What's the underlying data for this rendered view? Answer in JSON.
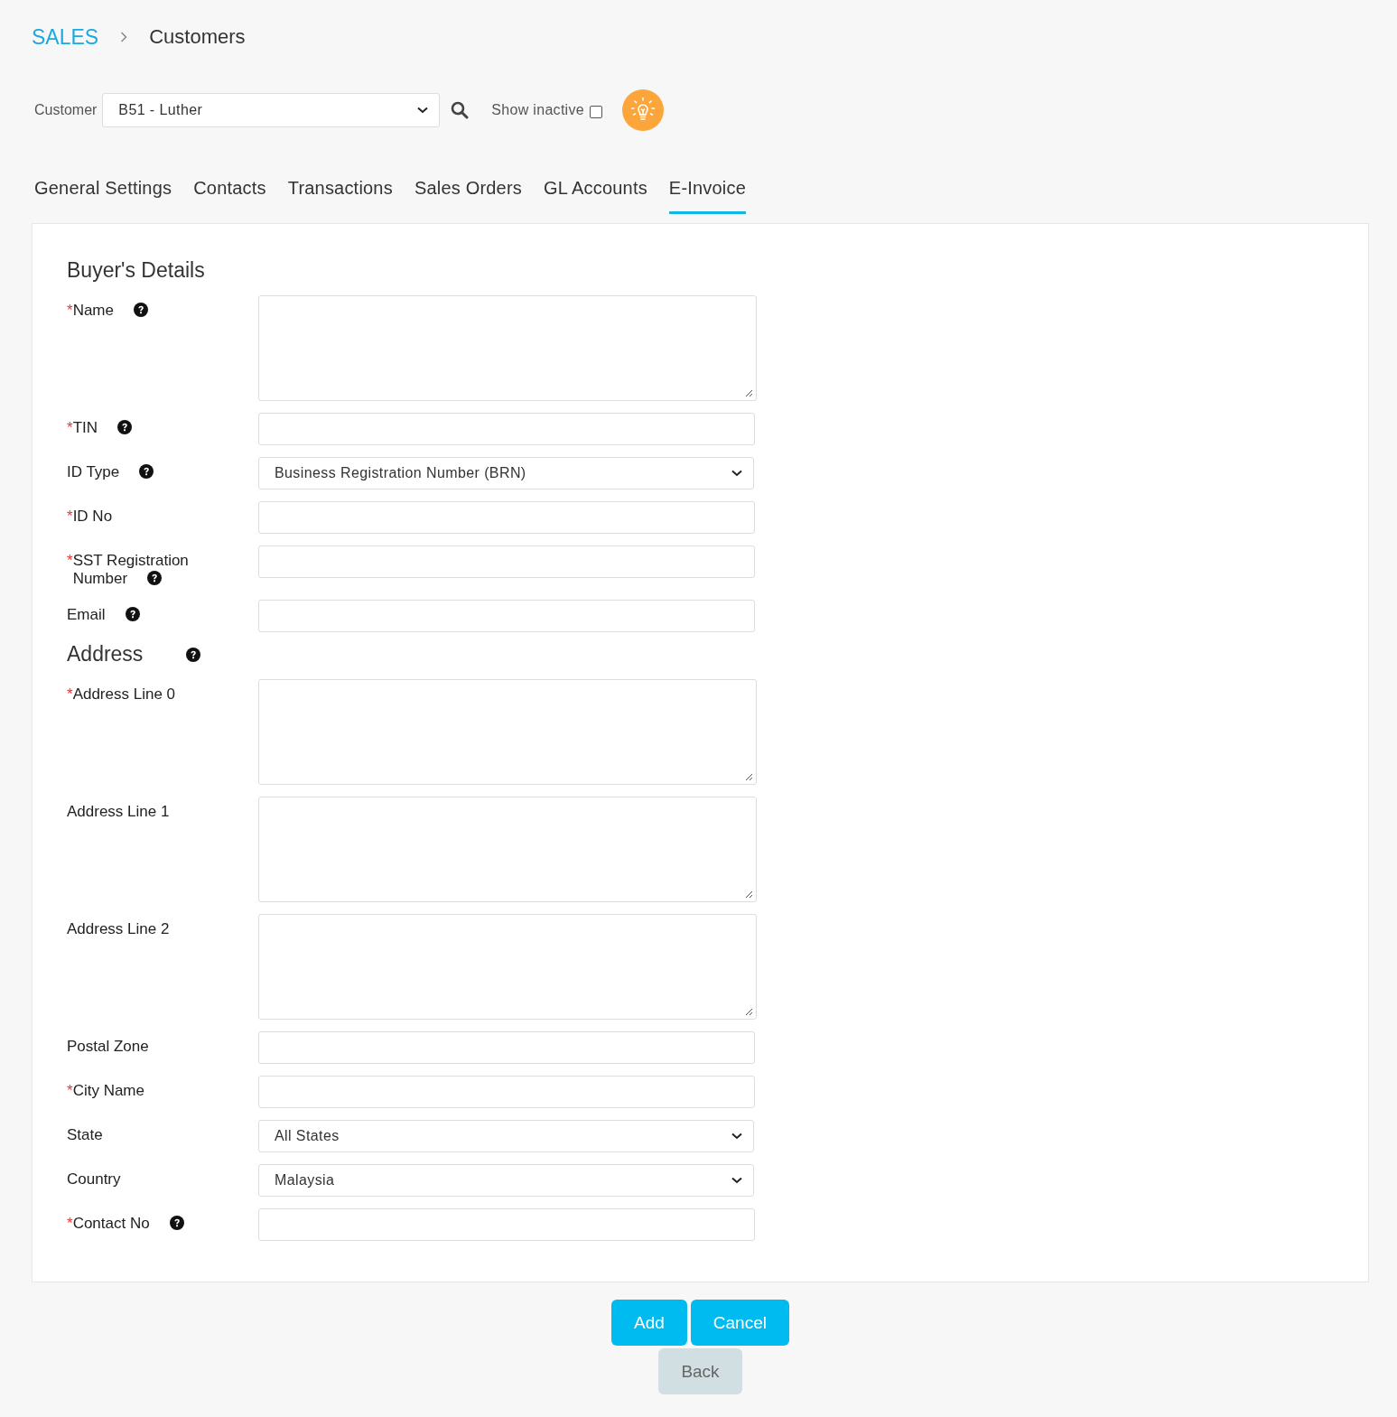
{
  "breadcrumb": {
    "section": "SALES",
    "page": "Customers"
  },
  "customer_bar": {
    "label": "Customer",
    "value": "B51 - Luther",
    "show_inactive": {
      "label": "Show inactive",
      "checked": false
    }
  },
  "tabs": [
    {
      "label": "General Settings",
      "selected": false
    },
    {
      "label": "Contacts",
      "selected": false
    },
    {
      "label": "Transactions",
      "selected": false
    },
    {
      "label": "Sales Orders",
      "selected": false
    },
    {
      "label": "GL Accounts",
      "selected": false
    },
    {
      "label": "E-Invoice",
      "selected": true
    }
  ],
  "form": {
    "title": "Buyer's Details",
    "rows": [
      {
        "kind": "textarea",
        "required_mark": "*",
        "label": "Name",
        "help": true
      },
      {
        "kind": "input",
        "required_mark": "*",
        "label": "TIN",
        "help": true
      },
      {
        "kind": "select",
        "label": "ID Type",
        "help": true,
        "value": "Business Registration Number (BRN)"
      },
      {
        "kind": "input",
        "required_mark": "*",
        "label": "ID No",
        "help": false
      },
      {
        "kind": "input",
        "required_mark": "*",
        "label": "SST Registration Number",
        "help": true
      },
      {
        "kind": "input",
        "label": "Email",
        "help": true
      },
      {
        "kind": "heading",
        "label": "Address",
        "help": true
      },
      {
        "kind": "textarea",
        "required_mark": "*",
        "label": "Address Line 0",
        "help": false
      },
      {
        "kind": "textarea",
        "label": "Address Line 1",
        "help": false
      },
      {
        "kind": "textarea",
        "label": "Address Line 2",
        "help": false
      },
      {
        "kind": "input",
        "label": "Postal Zone",
        "help": false
      },
      {
        "kind": "input",
        "required_mark": "*",
        "label": "City Name",
        "help": false
      },
      {
        "kind": "select",
        "label": "State",
        "help": false,
        "value": "All States"
      },
      {
        "kind": "select",
        "label": "Country",
        "help": false,
        "value": "Malaysia"
      },
      {
        "kind": "input",
        "required_mark": "*",
        "label": "Contact No",
        "help": true
      }
    ]
  },
  "buttons": [
    {
      "kind": "primary",
      "label": "Add"
    },
    {
      "kind": "primary",
      "label": "Cancel"
    },
    {
      "kind": "secondary",
      "label": "Back"
    }
  ]
}
